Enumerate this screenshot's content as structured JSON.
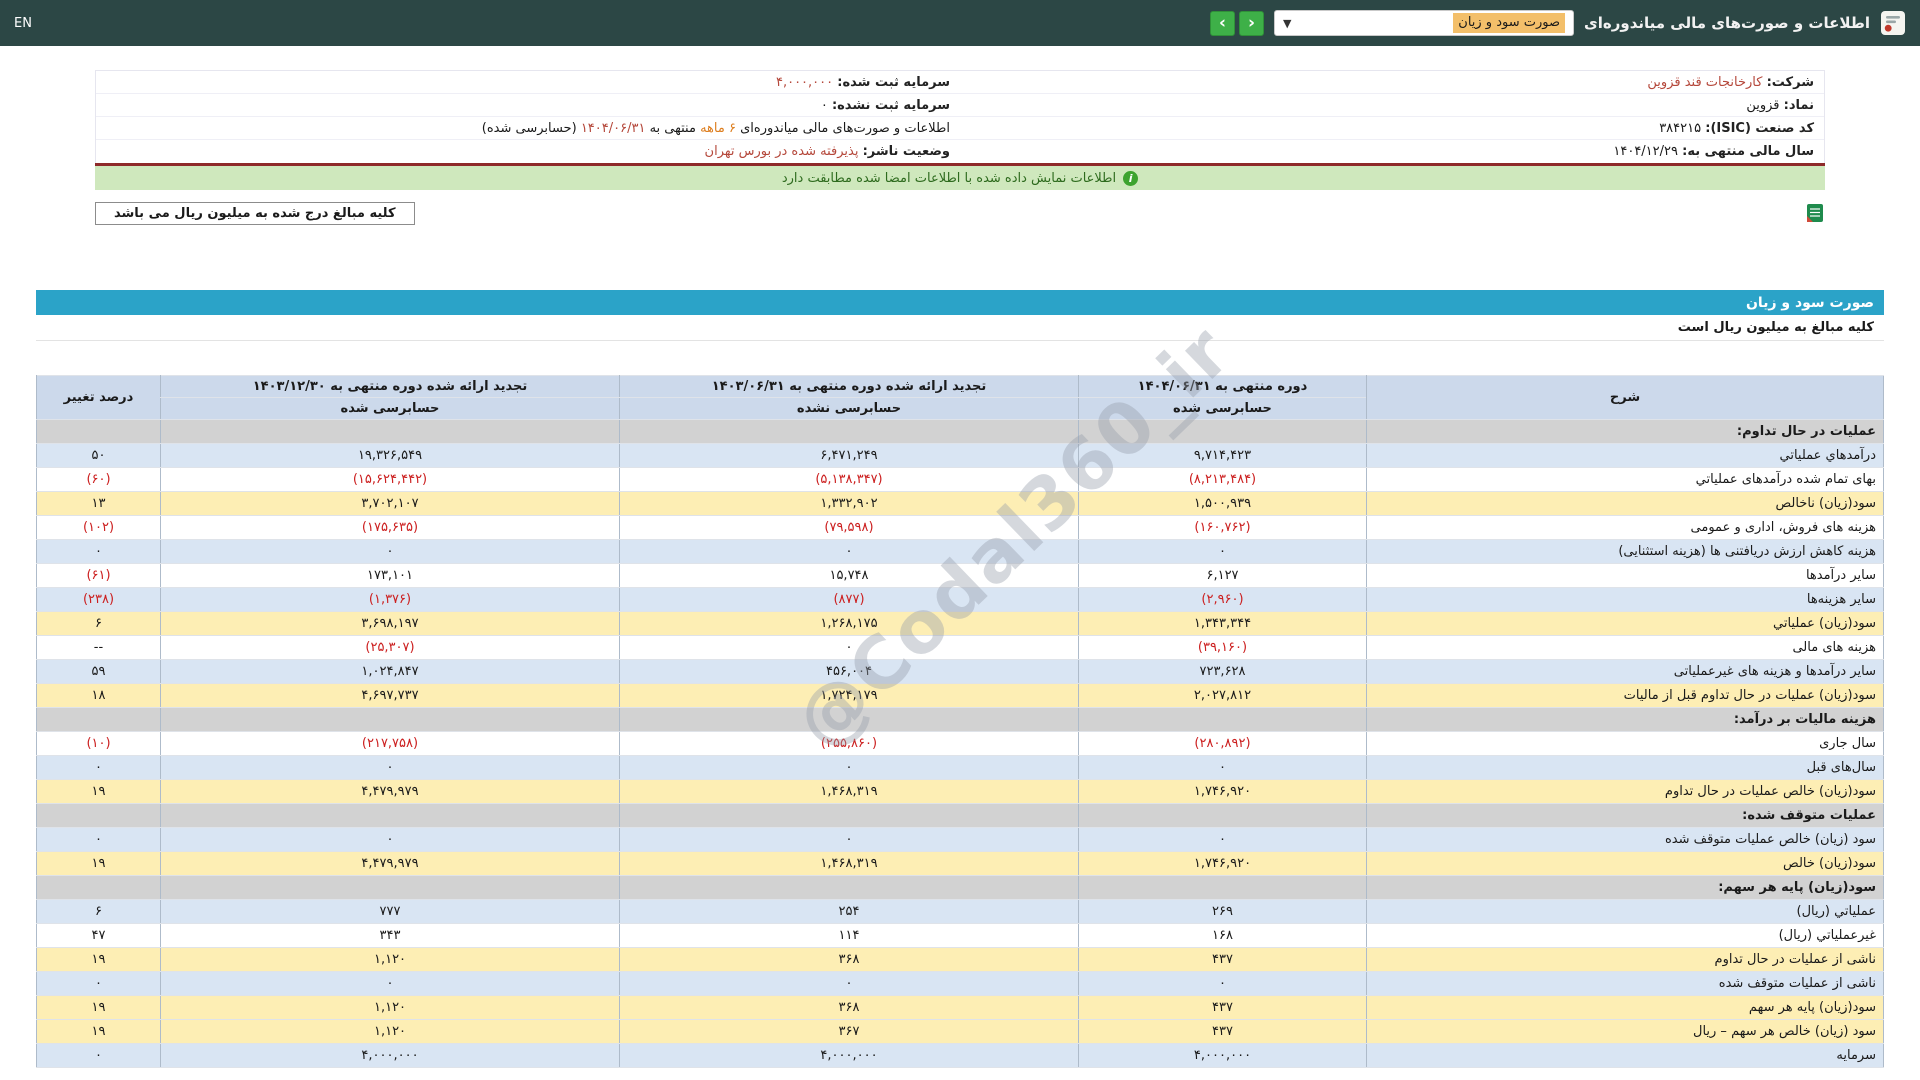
{
  "topbar": {
    "title": "اطلاعات و صورت‌های مالی میاندوره‌ای",
    "report_select_value": "صورت سود و زیان",
    "nav_prev": "‹",
    "nav_next": "›",
    "lang_toggle": "EN"
  },
  "company_info": {
    "company_label": "شرکت:",
    "company_value": "کارخانجات قند قزوین",
    "symbol_label": "نماد:",
    "symbol_value": "قزوین",
    "isic_label": "کد صنعت (ISIC):",
    "isic_value": "۳۸۴۲۱۵",
    "fiscal_year_label": "سال مالی منتهی به:",
    "fiscal_year_value": "۱۴۰۴/۱۲/۲۹",
    "registered_capital_label": "سرمایه ثبت شده:",
    "registered_capital_value": "۴,۰۰۰,۰۰۰",
    "unregistered_capital_label": "سرمایه ثبت نشده:",
    "unregistered_capital_value": "۰",
    "period_prefix": "اطلاعات و صورت‌های مالی میاندوره‌ای",
    "period_months": "۶ ماهه",
    "period_mid": "منتهی به",
    "period_date": "۱۴۰۴/۰۶/۳۱",
    "period_suffix": "(حسابرسی شده)",
    "publisher_status_label": "وضعیت ناشر:",
    "publisher_status_value": "پذیرفته شده در بورس تهران"
  },
  "signature_notice": "اطلاعات نمایش داده شده با اطلاعات امضا شده مطابقت دارد",
  "unit_note": "کلیه مبالغ درج شده به میلیون ریال می باشد",
  "statement": {
    "title": "صورت سود و زیان",
    "unit_line": "کلیه مبالغ به میلیون ریال است",
    "header": {
      "description": "شرح",
      "period1_title": "دوره منتهی به ۱۴۰۴/۰۶/۳۱",
      "period1_audit": "حسابرسی شده",
      "period2_title": "تجدید ارائه شده دوره منتهی به ۱۴۰۳/۰۶/۳۱",
      "period2_audit": "حسابرسی نشده",
      "period3_title": "تجدید ارائه شده دوره منتهی به ۱۴۰۳/۱۲/۳۰",
      "period3_audit": "حسابرسی شده",
      "change": "درصد تغییر"
    },
    "rows": [
      {
        "style": "section",
        "label": "عملیات در حال تداوم:",
        "values": [
          "",
          "",
          ""
        ],
        "change": ""
      },
      {
        "style": "blue",
        "label": "درآمدهاي عملياتي",
        "values": [
          "۹,۷۱۴,۴۲۳",
          "۶,۴۷۱,۲۴۹",
          "۱۹,۳۲۶,۵۴۹"
        ],
        "change": "۵۰"
      },
      {
        "style": "white",
        "label": "بهای تمام شده درآمدهای عملیاتي",
        "values": [
          "(۸,۲۱۳,۴۸۴)",
          "(۵,۱۳۸,۳۴۷)",
          "(۱۵,۶۲۴,۴۴۲)"
        ],
        "change": "(۶۰)"
      },
      {
        "style": "yellow",
        "label": "سود(زيان) ناخالص",
        "values": [
          "۱,۵۰۰,۹۳۹",
          "۱,۳۳۲,۹۰۲",
          "۳,۷۰۲,۱۰۷"
        ],
        "change": "۱۳"
      },
      {
        "style": "white",
        "label": "هزینه های فروش، اداری و عمومی",
        "values": [
          "(۱۶۰,۷۶۲)",
          "(۷۹,۵۹۸)",
          "(۱۷۵,۶۳۵)"
        ],
        "change": "(۱۰۲)"
      },
      {
        "style": "blue",
        "label": "هزینه کاهش ارزش دریافتنی ها (هزینه استثنایی)",
        "values": [
          "۰",
          "۰",
          "۰"
        ],
        "change": "۰"
      },
      {
        "style": "white",
        "label": "سایر درآمدها",
        "values": [
          "۶,۱۲۷",
          "۱۵,۷۴۸",
          "۱۷۳,۱۰۱"
        ],
        "change": "(۶۱)"
      },
      {
        "style": "blue",
        "label": "سایر هزینه‌ها",
        "values": [
          "(۲,۹۶۰)",
          "(۸۷۷)",
          "(۱,۳۷۶)"
        ],
        "change": "(۲۳۸)"
      },
      {
        "style": "yellow",
        "label": "سود(زيان) عملياتي",
        "values": [
          "۱,۳۴۳,۳۴۴",
          "۱,۲۶۸,۱۷۵",
          "۳,۶۹۸,۱۹۷"
        ],
        "change": "۶"
      },
      {
        "style": "white",
        "label": "هزینه های مالی",
        "values": [
          "(۳۹,۱۶۰)",
          "۰",
          "(۲۵,۳۰۷)"
        ],
        "change": "--"
      },
      {
        "style": "blue",
        "label": "سایر درآمدها و هزینه های غیرعملیاتی",
        "values": [
          "۷۲۳,۶۲۸",
          "۴۵۶,۰۰۴",
          "۱,۰۲۴,۸۴۷"
        ],
        "change": "۵۹"
      },
      {
        "style": "yellow",
        "label": "سود(زیان) عملیات در حال تداوم قبل از مالیات",
        "values": [
          "۲,۰۲۷,۸۱۲",
          "۱,۷۲۴,۱۷۹",
          "۴,۶۹۷,۷۳۷"
        ],
        "change": "۱۸"
      },
      {
        "style": "section",
        "label": "هزينه مالیات بر درآمد:",
        "values": [
          "",
          "",
          ""
        ],
        "change": ""
      },
      {
        "style": "white",
        "label": "سال جاری",
        "values": [
          "(۲۸۰,۸۹۲)",
          "(۲۵۵,۸۶۰)",
          "(۲۱۷,۷۵۸)"
        ],
        "change": "(۱۰)"
      },
      {
        "style": "blue",
        "label": "سال‌های قبل",
        "values": [
          "۰",
          "۰",
          "۰"
        ],
        "change": "۰"
      },
      {
        "style": "yellow",
        "label": "سود(زیان) خالص عملیات در حال تداوم",
        "values": [
          "۱,۷۴۶,۹۲۰",
          "۱,۴۶۸,۳۱۹",
          "۴,۴۷۹,۹۷۹"
        ],
        "change": "۱۹"
      },
      {
        "style": "section",
        "label": "عملیات متوقف شده:",
        "values": [
          "",
          "",
          ""
        ],
        "change": ""
      },
      {
        "style": "blue",
        "label": "سود (زیان) خالص عملیات متوقف شده",
        "values": [
          "۰",
          "۰",
          "۰"
        ],
        "change": "۰"
      },
      {
        "style": "yellow",
        "label": "سود(زیان) خالص",
        "values": [
          "۱,۷۴۶,۹۲۰",
          "۱,۴۶۸,۳۱۹",
          "۴,۴۷۹,۹۷۹"
        ],
        "change": "۱۹"
      },
      {
        "style": "section",
        "label": "سود(زیان) پایه هر سهم:",
        "values": [
          "",
          "",
          ""
        ],
        "change": ""
      },
      {
        "style": "blue",
        "label": "عملیاتي (ریال)",
        "values": [
          "۲۶۹",
          "۲۵۴",
          "۷۷۷"
        ],
        "change": "۶"
      },
      {
        "style": "white",
        "label": "غیرعملیاتي (ریال)",
        "values": [
          "۱۶۸",
          "۱۱۴",
          "۳۴۳"
        ],
        "change": "۴۷"
      },
      {
        "style": "yellow",
        "label": "ناشی از عملیات در حال تداوم",
        "values": [
          "۴۳۷",
          "۳۶۸",
          "۱,۱۲۰"
        ],
        "change": "۱۹"
      },
      {
        "style": "blue",
        "label": "ناشی از عملیات متوقف شده",
        "values": [
          "۰",
          "۰",
          "۰"
        ],
        "change": "۰"
      },
      {
        "style": "yellow",
        "label": "سود(زیان) پایه هر سهم",
        "values": [
          "۴۳۷",
          "۳۶۸",
          "۱,۱۲۰"
        ],
        "change": "۱۹"
      },
      {
        "style": "yellow",
        "label": "سود (زیان) خالص هر سهم – ریال",
        "values": [
          "۴۳۷",
          "۳۶۷",
          "۱,۱۲۰"
        ],
        "change": "۱۹"
      },
      {
        "style": "blue",
        "label": "سرمایه",
        "values": [
          "۴,۰۰۰,۰۰۰",
          "۴,۰۰۰,۰۰۰",
          "۴,۰۰۰,۰۰۰"
        ],
        "change": "۰"
      }
    ]
  },
  "watermark": "@Codal360_ir",
  "colors": {
    "topbar_bg": "#2c4745",
    "accent_blue": "#2ba3c8",
    "notice_green_bg": "#cfe8bd",
    "negative_red": "#cc2020",
    "highlight_yellow": "#fdeeb4",
    "row_blue": "#d9e5f3"
  }
}
